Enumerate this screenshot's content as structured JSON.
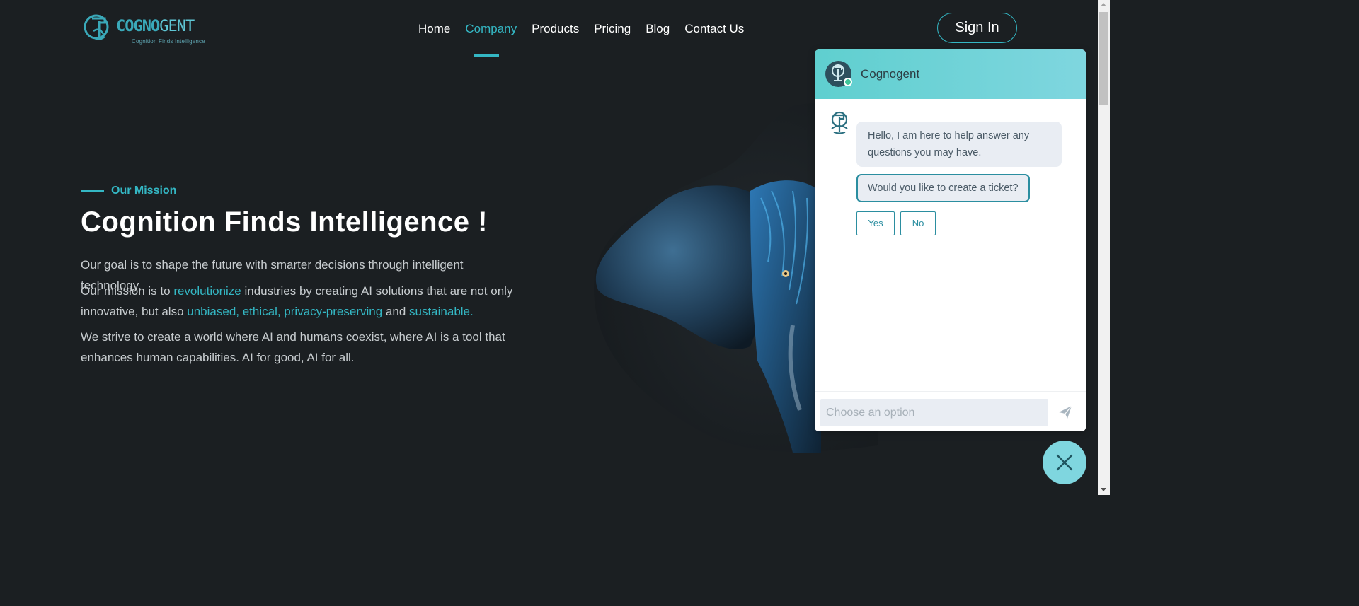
{
  "brand": {
    "name_bold": "COGNO",
    "name_light": "GENT",
    "tagline": "Cognition Finds Intelligence"
  },
  "nav": {
    "items": [
      "Home",
      "Company",
      "Products",
      "Pricing",
      "Blog",
      "Contact Us"
    ],
    "active": "Company",
    "signin_label": "Sign In"
  },
  "hero": {
    "eyebrow": "Our Mission",
    "title": "Cognition Finds Intelligence !",
    "p1": "Our goal is to shape the future with smarter decisions through intelligent technology.",
    "p2": {
      "a": "Our mission is to ",
      "b": "revolutionize",
      "c": " industries by creating AI solutions that are not only innovative, but also ",
      "d": "unbiased, ethical, privacy-preserving",
      "e": " and ",
      "f": "sustainable."
    },
    "p3": "We strive to create a world where AI and humans coexist, where AI is a tool that enhances human capabilities. AI for good, AI for all."
  },
  "chat": {
    "title": "Cognogent",
    "greeting": "Hello, I am here to help answer any questions you may have.",
    "question": "Would you like to create a ticket?",
    "options": [
      "Yes",
      "No"
    ],
    "input_placeholder": "Choose an option"
  },
  "colors": {
    "accent": "#34b7c4",
    "background": "#1b1f22",
    "chat_header": "#7fd6df"
  },
  "icons": {
    "logo": "cognogent-logo-icon",
    "send": "send-icon",
    "close": "close-icon",
    "bot": "bot-avatar-icon"
  }
}
